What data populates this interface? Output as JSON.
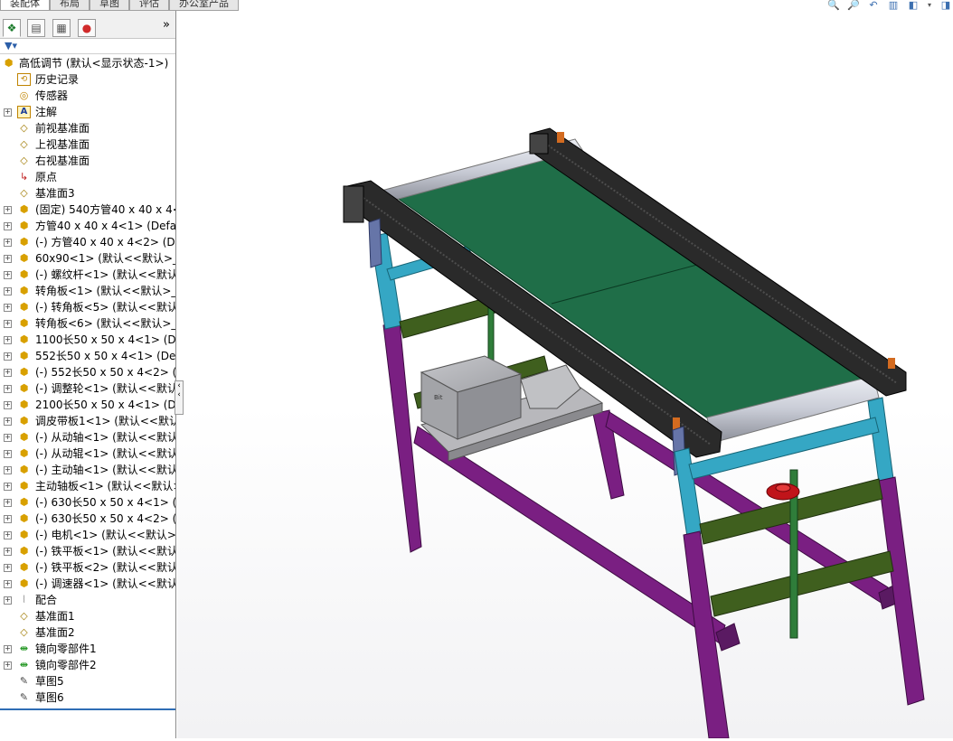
{
  "command_tabs": [
    "装配体",
    "布局",
    "草图",
    "评估",
    "办公室产品"
  ],
  "view_toolbar_icons": [
    "zoom-to-fit-icon",
    "zoom-to-area-icon",
    "previous-view-icon",
    "section-view-icon",
    "view-orientation-icon",
    "dropdown-arrow-icon",
    "display-style-icon"
  ],
  "pane_tabs": [
    "feature-manager-icon",
    "property-manager-icon",
    "configuration-manager-icon",
    "display-manager-icon"
  ],
  "pane_chevron": "»",
  "tree": {
    "root": "高低调节 (默认<显示状态-1>)",
    "items": [
      {
        "label": "历史记录",
        "icon": "history-icon",
        "expand": false
      },
      {
        "label": "传感器",
        "icon": "sensor-icon",
        "expand": false
      },
      {
        "label": "注解",
        "icon": "annotation-icon",
        "expand": true
      },
      {
        "label": "前视基准面",
        "icon": "plane-icon",
        "expand": false
      },
      {
        "label": "上视基准面",
        "icon": "plane-icon",
        "expand": false
      },
      {
        "label": "右视基准面",
        "icon": "plane-icon",
        "expand": false
      },
      {
        "label": "原点",
        "icon": "origin-icon",
        "expand": false
      },
      {
        "label": "基准面3",
        "icon": "plane-icon",
        "expand": false
      },
      {
        "label": "(固定) 540方管40 x 40 x 4<",
        "icon": "part-icon",
        "expand": true
      },
      {
        "label": "方管40 x 40 x 4<1> (Defau",
        "icon": "part-icon",
        "expand": true
      },
      {
        "label": "(-) 方管40 x 40 x 4<2> (De",
        "icon": "part-icon",
        "expand": true
      },
      {
        "label": "60x90<1> (默认<<默认>_外",
        "icon": "part-icon",
        "expand": true
      },
      {
        "label": "(-) 螺纹杆<1> (默认<<默认",
        "icon": "part-icon",
        "expand": true
      },
      {
        "label": "转角板<1> (默认<<默认>_5",
        "icon": "part-icon",
        "expand": true
      },
      {
        "label": "(-) 转角板<5> (默认<<默认",
        "icon": "part-icon",
        "expand": true
      },
      {
        "label": "转角板<6> (默认<<默认>_5",
        "icon": "part-icon",
        "expand": true
      },
      {
        "label": "1100长50 x 50 x 4<1> (De",
        "icon": "part-icon",
        "expand": true
      },
      {
        "label": "552长50 x 50 x 4<1> (Defa",
        "icon": "part-icon",
        "expand": true
      },
      {
        "label": "(-) 552长50 x 50 x 4<2> (D",
        "icon": "part-icon",
        "expand": true
      },
      {
        "label": "(-) 调整轮<1> (默认<<默认",
        "icon": "part-icon",
        "expand": true
      },
      {
        "label": "2100长50 x 50 x 4<1> (De",
        "icon": "part-icon",
        "expand": true
      },
      {
        "label": "调皮带板1<1> (默认<<默认",
        "icon": "part-icon",
        "expand": true
      },
      {
        "label": "(-) 从动轴<1> (默认<<默认",
        "icon": "part-icon",
        "expand": true
      },
      {
        "label": "(-) 从动辊<1> (默认<<默认",
        "icon": "part-icon",
        "expand": true
      },
      {
        "label": "(-) 主动轴<1> (默认<<默认",
        "icon": "part-icon",
        "expand": true
      },
      {
        "label": "主动轴板<1> (默认<<默认>",
        "icon": "part-icon",
        "expand": true
      },
      {
        "label": "(-) 630长50 x 50 x 4<1> (D",
        "icon": "part-icon",
        "expand": true
      },
      {
        "label": "(-) 630长50 x 50 x 4<2> (D",
        "icon": "part-icon",
        "expand": true
      },
      {
        "label": "(-) 电机<1> (默认<<默认>_",
        "icon": "part-icon",
        "expand": true
      },
      {
        "label": "(-) 铁平板<1> (默认<<默认",
        "icon": "part-icon",
        "expand": true
      },
      {
        "label": "(-) 铁平板<2> (默认<<默认",
        "icon": "part-icon",
        "expand": true
      },
      {
        "label": "(-) 调速器<1> (默认<<默认",
        "icon": "part-icon",
        "expand": true
      },
      {
        "label": "配合",
        "icon": "mates-icon",
        "expand": true
      },
      {
        "label": "基准面1",
        "icon": "plane-icon",
        "expand": false
      },
      {
        "label": "基准面2",
        "icon": "plane-icon",
        "expand": false
      },
      {
        "label": "镜向零部件1",
        "icon": "mirror-component-icon",
        "expand": true
      },
      {
        "label": "镜向零部件2",
        "icon": "mirror-component-icon",
        "expand": true
      },
      {
        "label": "草图5",
        "icon": "sketch-icon",
        "expand": false
      },
      {
        "label": "草图6",
        "icon": "sketch-icon",
        "expand": false
      }
    ]
  },
  "motor_label": "Bit",
  "colors": {
    "belt": "#1f6e48",
    "frame_top": "#2a2a2a",
    "leg_cyan": "#35a7c4",
    "leg_purple": "#7a1f82",
    "crossbar_green": "#3f5f1e",
    "motor_gray": "#a3a4a8",
    "handwheel_red": "#c0141a",
    "roller_silver": "#c9ccd6",
    "bracket_blue": "#6675a8",
    "accent_orange": "#d36b20"
  }
}
